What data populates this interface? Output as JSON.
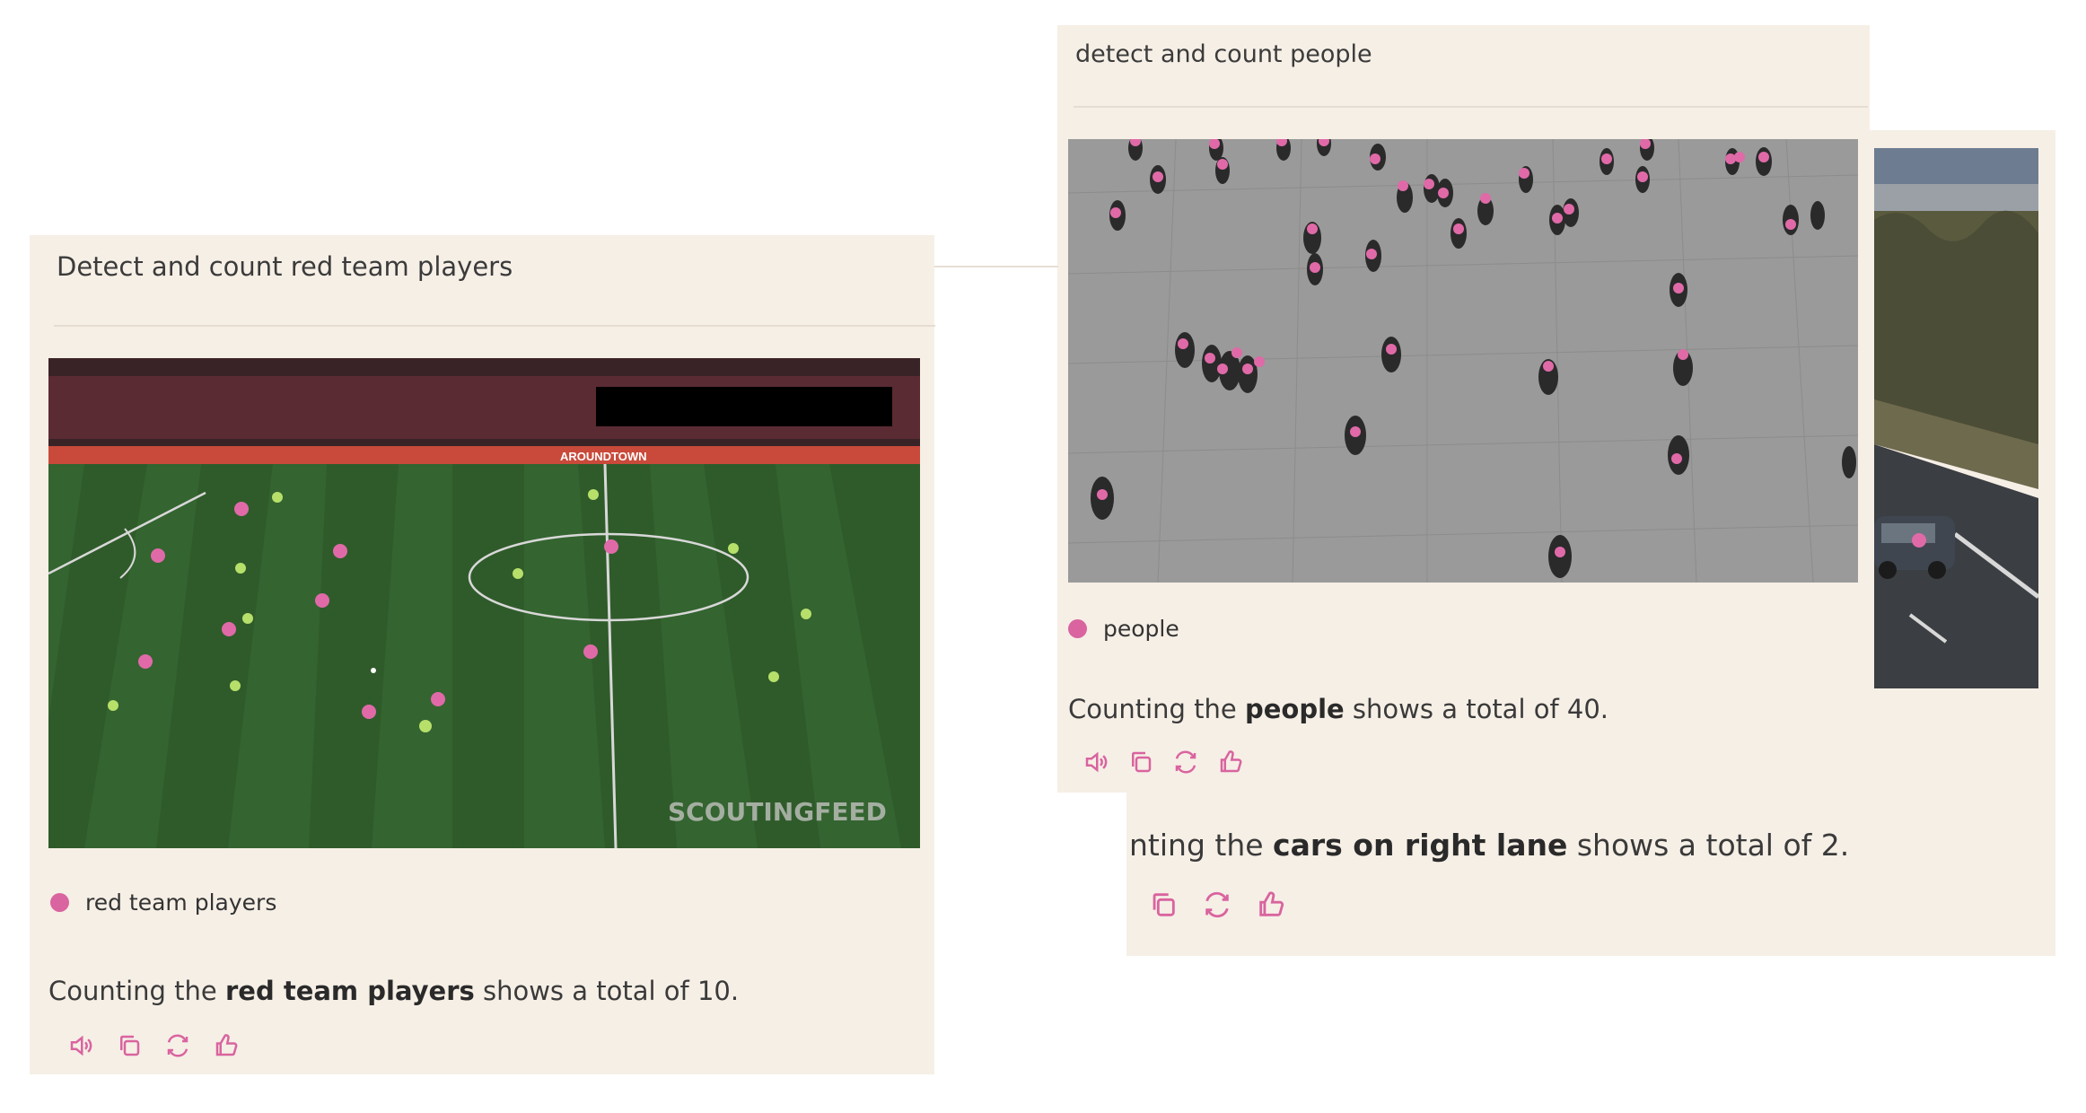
{
  "colors": {
    "panel_bg": "#f6efe6",
    "marker": "#d9649f",
    "icon": "#d9649f"
  },
  "left_panel": {
    "prompt": "Detect and count red team players",
    "image": {
      "watermark": "SCOUTINGFEED",
      "ad_board_text": "AROUNDTOWN"
    },
    "legend_label": "red team players",
    "answer": {
      "prefix": "Counting the ",
      "target": "red team players",
      "suffix": " shows a total of 10."
    },
    "actions": [
      "speaker-icon",
      "copy-icon",
      "refresh-icon",
      "thumbs-up-icon"
    ]
  },
  "right_panel": {
    "prompt": "detect and count people",
    "legend_label": "people",
    "answer": {
      "prefix": "Counting the ",
      "target": "people",
      "suffix": " shows a total of 40."
    },
    "actions": [
      "speaker-icon",
      "copy-icon",
      "refresh-icon",
      "thumbs-up-icon"
    ]
  },
  "third_panel": {
    "answer": {
      "prefix": "nting the ",
      "target": "cars on right lane",
      "suffix": " shows a total of 2."
    },
    "actions": [
      "copy-icon",
      "refresh-icon",
      "thumbs-up-icon"
    ]
  }
}
